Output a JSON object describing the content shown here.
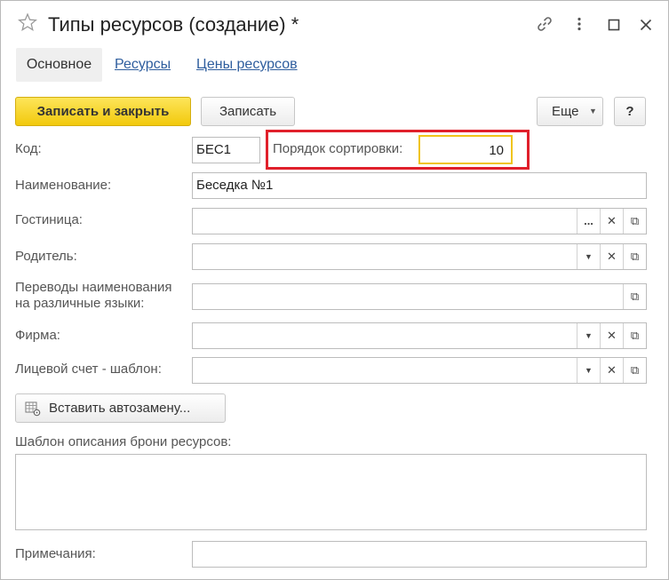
{
  "window": {
    "title": "Типы ресурсов (создание) *"
  },
  "tabs": [
    {
      "label": "Основное"
    },
    {
      "label": "Ресурсы"
    },
    {
      "label": "Цены ресурсов"
    }
  ],
  "toolbar": {
    "save_close_label": "Записать и закрыть",
    "save_label": "Записать",
    "more_label": "Еще",
    "help_label": "?"
  },
  "form": {
    "code_label": "Код:",
    "code_value": "БЕС1",
    "sort_label": "Порядок сортировки:",
    "sort_value": "10",
    "name_label": "Наименование:",
    "name_value": "Беседка №1",
    "hotel_label": "Гостиница:",
    "hotel_value": "",
    "parent_label": "Родитель:",
    "parent_value": "",
    "translations_label_1": "Переводы наименования",
    "translations_label_2": "на различные языки:",
    "translations_value": "",
    "firm_label": "Фирма:",
    "firm_value": "",
    "account_label": "Лицевой счет - шаблон:",
    "account_value": "",
    "autoreplace_label": "Вставить автозамену...",
    "template_label": "Шаблон описания брони ресурсов:",
    "template_value": "",
    "notes_label": "Примечания:",
    "notes_value": ""
  },
  "colors": {
    "primary_button": "#f2c90c",
    "link": "#2f5e9e",
    "highlight_frame": "#e0202b",
    "active_field_border": "#f0c419"
  }
}
